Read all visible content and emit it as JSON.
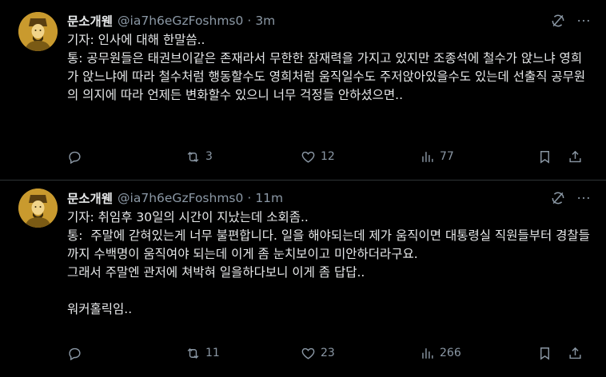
{
  "tweets": [
    {
      "display_name": "문소개웬",
      "handle": "@ia7h6eGzFoshms0",
      "separator": "·",
      "time": "3m",
      "text": "기자: 인사에 대해 한말씀..\n통: 공무원들은 태권브이같은 존재라서 무한한 잠재력을 가지고 있지만 조종석에 철수가 앉느냐 영희가 앉느냐에 따라 철수처럼 행동할수도 영희처럼 움직일수도 주저앉아있을수도 있는데 선출직 공무원의 의지에 따라 언제든 변화할수 있으니 너무 걱정들 안하셨으면..",
      "replies": "",
      "retweets": "3",
      "likes": "12",
      "views": "77",
      "icons": {
        "grok": "grok-icon",
        "more": "more-icon",
        "reply": "reply-icon",
        "retweet": "retweet-icon",
        "like": "heart-icon",
        "views": "views-icon",
        "bookmark": "bookmark-icon",
        "share": "share-icon"
      }
    },
    {
      "display_name": "문소개웬",
      "handle": "@ia7h6eGzFoshms0",
      "separator": "·",
      "time": "11m",
      "text": "기자: 취임후 30일의 시간이 지났는데 소회좀..\n통:  주말에 갇혀있는게 너무 불편합니다. 일을 해야되는데 제가 움직이면 대통령실 직원들부터 경찰들까지 수백명이 움직여야 되는데 이게 좀 눈치보이고 미안하더라구요.\n그래서 주말엔 관저에 쳐박혀 일을하다보니 이게 좀 답답..\n\n워커홀릭임..",
      "replies": "",
      "retweets": "11",
      "likes": "23",
      "views": "266",
      "icons": {
        "grok": "grok-icon",
        "more": "more-icon",
        "reply": "reply-icon",
        "retweet": "retweet-icon",
        "like": "heart-icon",
        "views": "views-icon",
        "bookmark": "bookmark-icon",
        "share": "share-icon"
      }
    }
  ],
  "colors": {
    "background": "#000000",
    "text": "#e7e9ea",
    "secondary": "#8b98a5",
    "divider": "#2f3336",
    "avatar_gold": "#d8b04a"
  }
}
